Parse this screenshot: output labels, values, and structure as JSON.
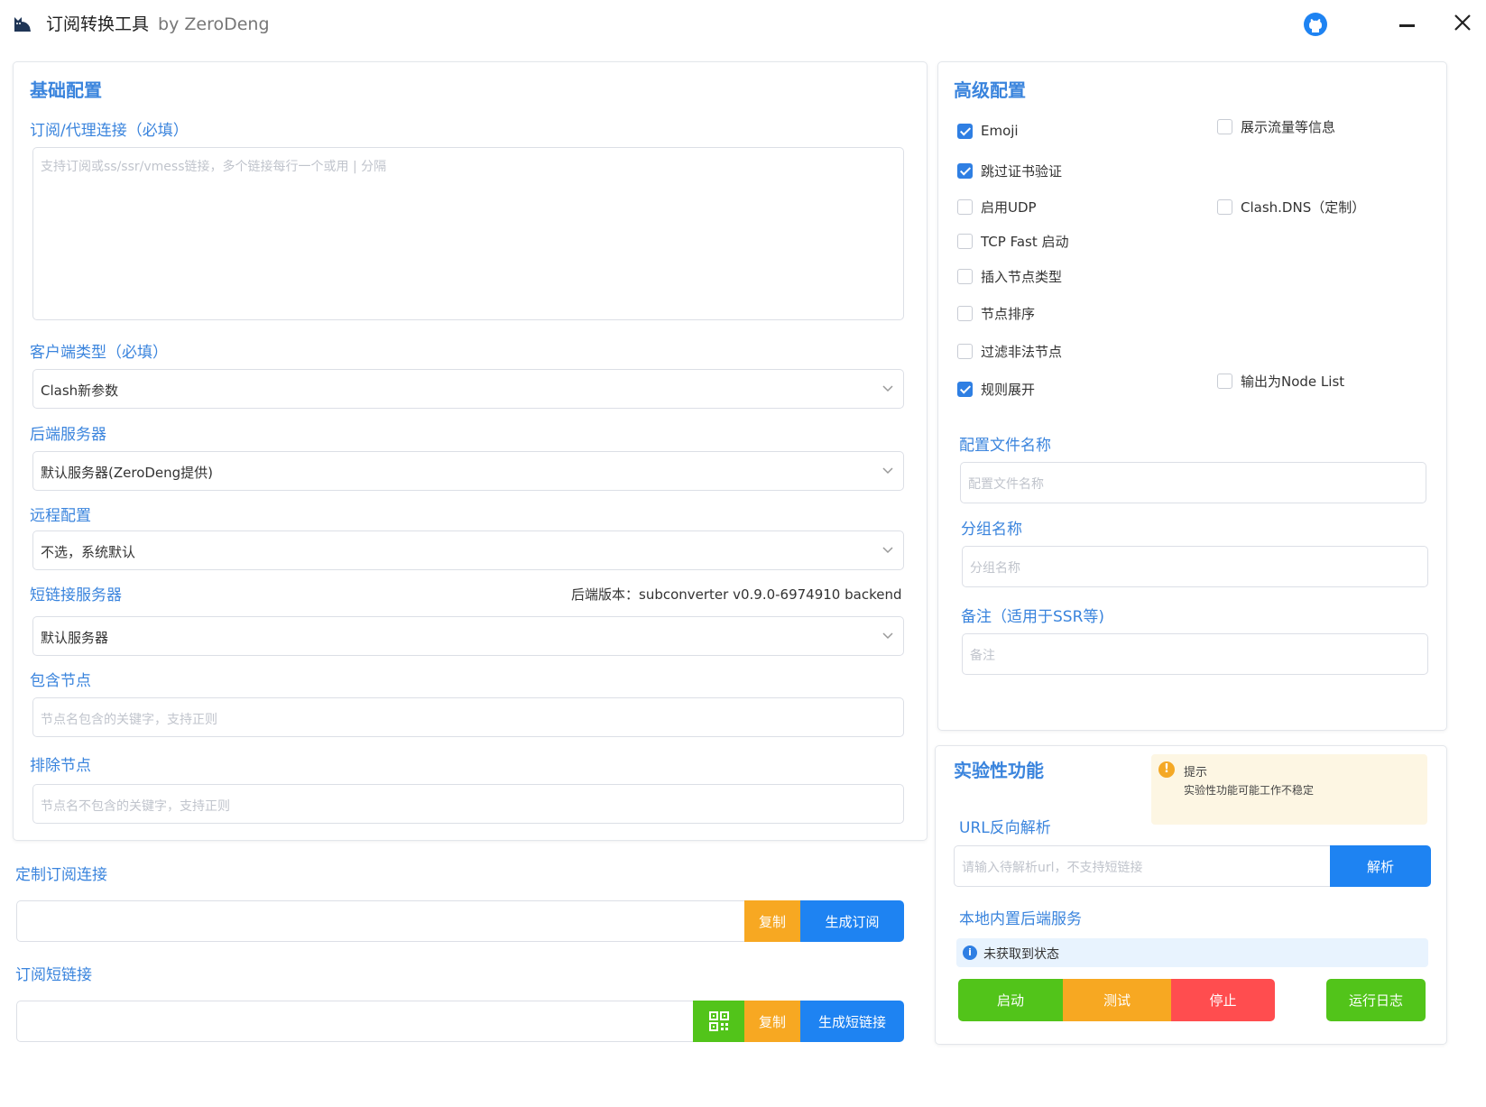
{
  "window": {
    "title": "订阅转换工具",
    "byline": "by ZeroDeng",
    "icons": [
      "cat-icon",
      "github-icon",
      "minimize-icon",
      "close-icon"
    ]
  },
  "basic": {
    "title": "基础配置",
    "sub_label": "订阅/代理连接（必填）",
    "sub_placeholder": "支持订阅或ss/ssr/vmess链接，多个链接每行一个或用 | 分隔",
    "client_label": "客户端类型（必填）",
    "client_value": "Clash新参数",
    "backend_label": "后端服务器",
    "backend_value": "默认服务器(ZeroDeng提供)",
    "remote_label": "远程配置",
    "remote_value": "不选，系统默认",
    "short_label": "短链接服务器",
    "backend_version": "后端版本：subconverter v0.9.0-6974910 backend",
    "short_value": "默认服务器",
    "include_label": "包含节点",
    "include_placeholder": "节点名包含的关键字，支持正则",
    "exclude_label": "排除节点",
    "exclude_placeholder": "节点名不包含的关键字，支持正则"
  },
  "custom": {
    "label": "定制订阅连接",
    "copy": "复制",
    "generate": "生成订阅"
  },
  "shortlink": {
    "label": "订阅短链接",
    "copy": "复制",
    "generate": "生成短链接"
  },
  "advanced": {
    "title": "高级配置",
    "options": [
      {
        "label": "Emoji",
        "checked": true
      },
      {
        "label": "展示流量等信息",
        "checked": false
      },
      {
        "label": "跳过证书验证",
        "checked": true
      },
      {
        "label": "启用UDP",
        "checked": false
      },
      {
        "label": "Clash.DNS（定制）",
        "checked": false
      },
      {
        "label": "TCP Fast 启动",
        "checked": false
      },
      {
        "label": "插入节点类型",
        "checked": false
      },
      {
        "label": "节点排序",
        "checked": false
      },
      {
        "label": "过滤非法节点",
        "checked": false
      },
      {
        "label": "输出为Node List",
        "checked": false
      },
      {
        "label": "规则展开",
        "checked": true
      }
    ],
    "filename_label": "配置文件名称",
    "filename_placeholder": "配置文件名称",
    "group_label": "分组名称",
    "group_placeholder": "分组名称",
    "remark_label": "备注（适用于SSR等)",
    "remark_placeholder": "备注"
  },
  "experimental": {
    "title": "实验性功能",
    "tip_title": "提示",
    "tip_text": "实验性功能可能工作不稳定",
    "url_label": "URL反向解析",
    "url_placeholder": "请输入待解析url，不支持短链接",
    "parse": "解析",
    "local_label": "本地内置后端服务",
    "status": "未获取到状态",
    "start": "启动",
    "test": "测试",
    "stop": "停止",
    "log": "运行日志"
  }
}
